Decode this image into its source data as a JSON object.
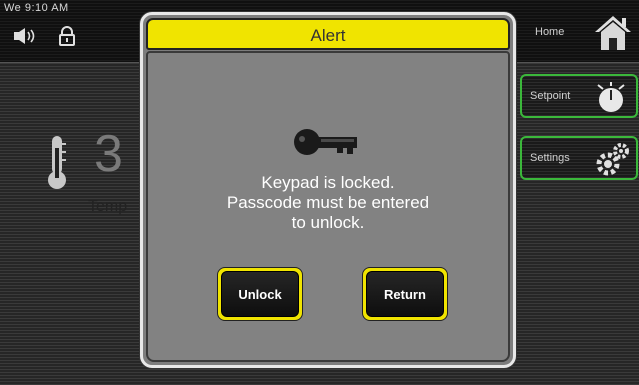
{
  "status_bar": {
    "time": "We 9:10 AM"
  },
  "background": {
    "temperature_partial": "3",
    "temperature_label_partial": "Temp"
  },
  "nav": {
    "home_label": "Home",
    "setpoint_label": "Setpoint",
    "settings_label": "Settings"
  },
  "icons": {
    "volume": "speaker-icon",
    "lock": "padlock-icon",
    "home": "house-icon",
    "setpoint": "thermostat-dial-icon",
    "settings": "gears-icon",
    "thermometer": "thermometer-icon",
    "key": "key-icon"
  },
  "alert": {
    "title": "Alert",
    "message_line1": "Keypad is locked.",
    "message_line2": "Passcode must be entered",
    "message_line3": "to unlock.",
    "unlock_label": "Unlock",
    "return_label": "Return"
  },
  "colors": {
    "alert_header": "#f0e400",
    "accent_border": "#3bb83b",
    "button_border": "#f0e400"
  }
}
